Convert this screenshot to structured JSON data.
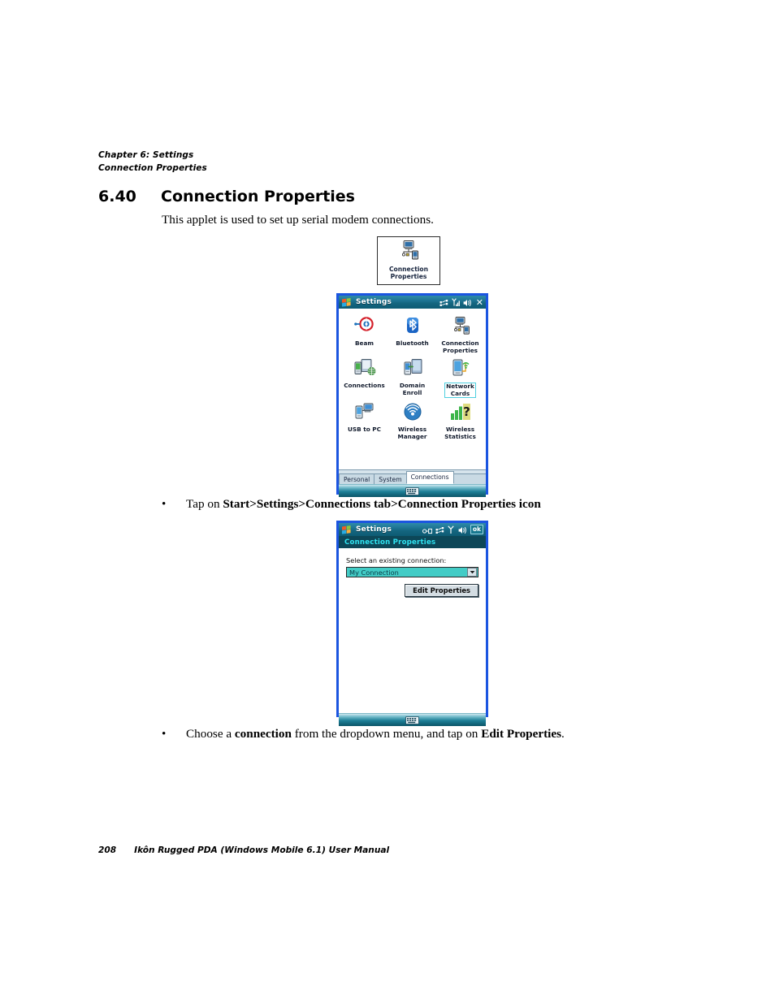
{
  "page": {
    "header_chapter": "Chapter 6:  Settings",
    "header_section": "Connection Properties",
    "section_number": "6.40",
    "section_title": "Connection Properties",
    "intro": "This applet is used to set up serial modem connections.",
    "footer_page_number": "208",
    "footer_title": "Ikôn Rugged PDA (Windows Mobile 6.1) User Manual"
  },
  "applet_icon": {
    "icon": "connection-properties-icon",
    "label_line1": "Connection",
    "label_line2": "Properties"
  },
  "bullets": [
    {
      "marker": "•",
      "parts": [
        {
          "text": "Tap on ",
          "bold": false
        },
        {
          "text": "Start>Settings>Connections tab>Connection Properties icon",
          "bold": true
        }
      ]
    },
    {
      "marker": "•",
      "parts": [
        {
          "text": "Choose a ",
          "bold": false
        },
        {
          "text": "connection",
          "bold": true
        },
        {
          "text": " from the dropdown menu, and tap on ",
          "bold": false
        },
        {
          "text": "Edit Properties",
          "bold": true
        },
        {
          "text": ".",
          "bold": false
        }
      ]
    }
  ],
  "settings_screen": {
    "titlebar": {
      "start_icon": "windows-start-icon",
      "title": "Settings",
      "status_icons": [
        "connectivity-icon",
        "signal-icon",
        "volume-icon"
      ],
      "close_label": "✕"
    },
    "icons": [
      {
        "name": "beam-icon",
        "label": "Beam",
        "label2": "",
        "selected": false
      },
      {
        "name": "bluetooth-icon",
        "label": "Bluetooth",
        "label2": "",
        "selected": false
      },
      {
        "name": "connection-properties-icon",
        "label": "Connection",
        "label2": "Properties",
        "selected": false
      },
      {
        "name": "connections-icon",
        "label": "Connections",
        "label2": "",
        "selected": false
      },
      {
        "name": "domain-enroll-icon",
        "label": "Domain",
        "label2": "Enroll",
        "selected": false
      },
      {
        "name": "network-cards-icon",
        "label": "Network",
        "label2": "Cards",
        "selected": true
      },
      {
        "name": "usb-to-pc-icon",
        "label": "USB to PC",
        "label2": "",
        "selected": false
      },
      {
        "name": "wireless-manager-icon",
        "label": "Wireless",
        "label2": "Manager",
        "selected": false
      },
      {
        "name": "wireless-statistics-icon",
        "label": "Wireless",
        "label2": "Statistics",
        "selected": false
      }
    ],
    "tabs": [
      {
        "label": "Personal",
        "active": false
      },
      {
        "label": "System",
        "active": false
      },
      {
        "label": "Connections",
        "active": true
      }
    ],
    "taskbar_icon": "soft-keyboard-icon"
  },
  "connection_properties_screen": {
    "titlebar": {
      "start_icon": "windows-start-icon",
      "title": "Settings",
      "status_icons": [
        "modem-icon",
        "connectivity-icon",
        "signal-icon",
        "volume-icon"
      ],
      "ok_label": "ok"
    },
    "subheader": "Connection Properties",
    "field_label": "Select an existing connection:",
    "dropdown_value": "My Connection",
    "dropdown_arrow": "chevron-down-icon",
    "edit_button_label": "Edit Properties",
    "taskbar_icon": "soft-keyboard-icon"
  },
  "colors": {
    "device_border": "#1b55e0",
    "titlebar": "#14657f",
    "subheader_bg": "#0d4758",
    "subheader_text": "#2fe2f0",
    "combo_selected": "#43ccc6",
    "selection_outline": "#4fd0e0"
  }
}
